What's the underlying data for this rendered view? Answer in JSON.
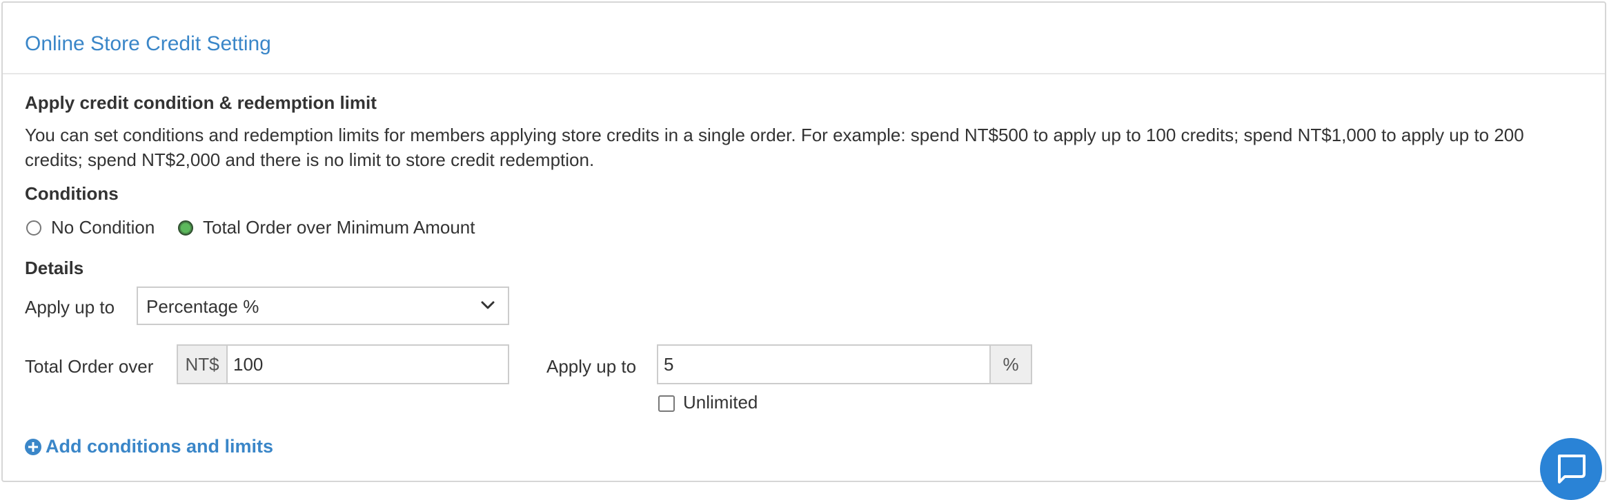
{
  "panel": {
    "title": "Online Store Credit Setting"
  },
  "section": {
    "heading": "Apply credit condition & redemption limit",
    "description": "You can set conditions and redemption limits for members applying store credits in a single order. For example: spend NT$500 to apply up to 100 credits; spend NT$1,000 to apply up to 200 credits; spend NT$2,000 and there is no limit to store credit redemption."
  },
  "conditions": {
    "heading": "Conditions",
    "options": [
      {
        "label": "No Condition",
        "checked": false
      },
      {
        "label": "Total Order over Minimum Amount",
        "checked": true
      }
    ]
  },
  "details": {
    "heading": "Details",
    "apply_up_to_label": "Apply up to",
    "apply_type_selected": "Percentage %",
    "total_order_label": "Total Order over",
    "currency_prefix": "NT$",
    "total_order_value": "100",
    "apply_limit_label": "Apply up to",
    "apply_limit_value": "5",
    "apply_limit_suffix": "%",
    "unlimited_label": "Unlimited",
    "unlimited_checked": false
  },
  "actions": {
    "add_conditions_label": "Add conditions and limits"
  },
  "icons": {
    "select_chevron": "chevron-down-icon",
    "add": "plus-circle-icon",
    "chat": "chat-icon"
  },
  "colors": {
    "accent": "#3a86c8",
    "radio_checked": "#5cb85c",
    "chat_button": "#2a83d6"
  }
}
